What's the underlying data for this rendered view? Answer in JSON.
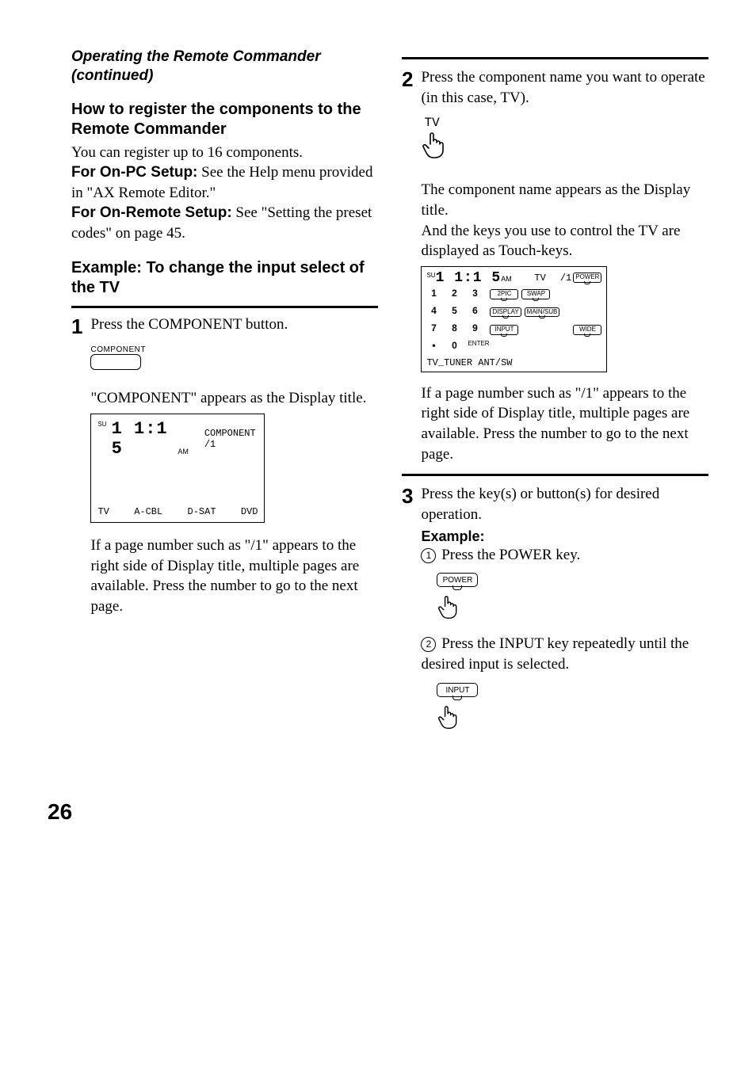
{
  "left": {
    "continuedTitle": "Operating the Remote Commander (continued)",
    "h_register": "How to register the components to the Remote Commander",
    "register_intro": "You can register up to 16 components.",
    "onpc_label": "For On-PC Setup:",
    "onpc_text": " See the Help menu provided in \"AX Remote Editor.\"",
    "onremote_label": "For On-Remote Setup:",
    "onremote_text": " See \"Setting the preset codes\" on page 45.",
    "h_example": "Example: To change the input select of the TV",
    "step1_text": "Press the COMPONENT button.",
    "component_caption": "COMPONENT",
    "after_btn": "\"COMPONENT\" appears as the Display title.",
    "lcd1": {
      "su": "SU",
      "clock": "1 1:1 5",
      "ampm": "AM",
      "title": "COMPONENT /1",
      "opts": [
        "TV",
        "A-CBL",
        "D-SAT",
        "DVD"
      ]
    },
    "page_note": "If a page number such as \"/1\" appears to the right side of Display title, multiple pages are available. Press the number to go to the next page."
  },
  "right": {
    "step2_text": "Press the component name you want to operate (in this case, TV).",
    "tv_touch_label": "TV",
    "after_tv_1": "The component name appears as the Display title.",
    "after_tv_2": "And the keys you use to control the TV are displayed as Touch-keys.",
    "lcd2": {
      "su": "SU",
      "clock": "1 1:1 5",
      "ampm": "AM",
      "title": "TV",
      "page": "/1",
      "power": "POWER",
      "nums": [
        "1",
        "2",
        "3",
        "4",
        "5",
        "6",
        "7",
        "8",
        "9",
        "•",
        "0"
      ],
      "enter": "ENTER",
      "keys_row1": [
        "2PIC",
        "SWAP"
      ],
      "keys_row2": [
        "DISPLAY",
        "MAIN/SUB"
      ],
      "keys_row3": [
        "INPUT"
      ],
      "keys_row3_right": [
        "WIDE"
      ],
      "footer": "TV_TUNER ANT/SW"
    },
    "page_note": "If a page number such as \"/1\" appears to the right side of Display title, multiple pages are available. Press the number to go to the next page.",
    "step3_text": "Press the key(s) or button(s) for desired operation.",
    "example_label": "Example:",
    "sub1_text": " Press the POWER key.",
    "power_key": "POWER",
    "sub2_text": " Press the INPUT key repeatedly until the desired input is selected.",
    "input_key": "INPUT"
  },
  "pageNumber": "26"
}
